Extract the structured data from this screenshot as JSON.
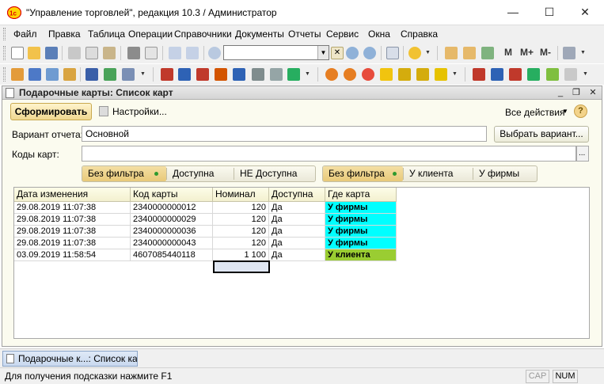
{
  "window": {
    "title": "\"Управление торговлей\", редакция 10.3 / Администратор",
    "minimize_glyph": "—",
    "maximize_glyph": "☐",
    "close_glyph": "✕"
  },
  "menu": {
    "items": [
      {
        "label": "Файл"
      },
      {
        "label": "Правка"
      },
      {
        "label": "Таблица"
      },
      {
        "label": "Операции"
      },
      {
        "label": "Справочники"
      },
      {
        "label": "Документы"
      },
      {
        "label": "Отчеты"
      },
      {
        "label": "Сервис"
      },
      {
        "label": "Окна"
      },
      {
        "label": "Справка"
      }
    ]
  },
  "toolbar": {
    "memory_buttons": [
      "M",
      "M+",
      "M-"
    ],
    "search_value": ""
  },
  "document": {
    "title": "Подарочные карты: Список карт",
    "generate_button": "Сформировать",
    "settings_button": "Настройки...",
    "all_actions": "Все действия",
    "help_glyph": "?",
    "variant_label": "Вариант отчета:",
    "variant_value": "Основной",
    "choose_variant_button": "Выбрать вариант...",
    "codes_label": "Коды карт:",
    "codes_value": "",
    "codes_select_glyph": "...",
    "filter_availability": [
      "Без фильтра",
      "Доступна",
      "НЕ Доступна"
    ],
    "filter_location": [
      "Без фильтра",
      "У клиента",
      "У фирмы"
    ]
  },
  "table": {
    "columns": [
      "Дата изменения",
      "Код карты",
      "Номинал",
      "Доступна",
      "Где карта"
    ],
    "rows": [
      {
        "date": "29.08.2019 11:07:38",
        "code": "2340000000012",
        "nominal": "120",
        "available": "Да",
        "where": "У фирмы"
      },
      {
        "date": "29.08.2019 11:07:38",
        "code": "2340000000029",
        "nominal": "120",
        "available": "Да",
        "where": "У фирмы"
      },
      {
        "date": "29.08.2019 11:07:38",
        "code": "2340000000036",
        "nominal": "120",
        "available": "Да",
        "where": "У фирмы"
      },
      {
        "date": "29.08.2019 11:07:38",
        "code": "2340000000043",
        "nominal": "120",
        "available": "Да",
        "where": "У фирмы"
      },
      {
        "date": "03.09.2019 11:58:54",
        "code": "4607085440118",
        "nominal": "1 100",
        "available": "Да",
        "where": "У клиента"
      }
    ],
    "colors": {
      "at_firm": "#00ffff",
      "at_client": "#9acd32"
    }
  },
  "taskbar": {
    "tab_label": "Подарочные к...: Список карт"
  },
  "status": {
    "hint": "Для получения подсказки нажмите F1",
    "cap": "CAP",
    "num": "NUM"
  }
}
